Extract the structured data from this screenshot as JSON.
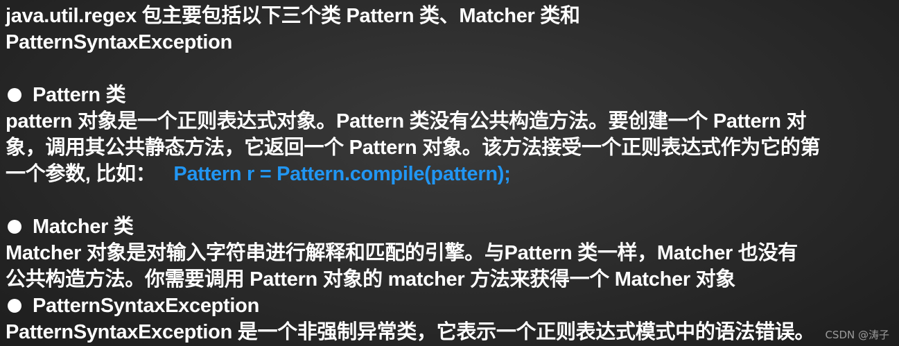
{
  "intro": {
    "line1": "java.util.regex 包主要包括以下三个类 Pattern 类、Matcher 类和",
    "line2": "PatternSyntaxException"
  },
  "pattern_section": {
    "title": "Pattern 类",
    "line1": "pattern 对象是一个正则表达式对象。Pattern 类没有公共构造方法。要创建一个 Pattern 对",
    "line2": "象，调用其公共静态方法，它返回一个 Pattern 对象。该方法接受一个正则表达式作为它的第",
    "line3": "一个参数, 比如：",
    "code": "Pattern r = Pattern.compile(pattern);"
  },
  "matcher_section": {
    "title": "Matcher 类",
    "line1": "Matcher 对象是对输入字符串进行解释和匹配的引擎。与Pattern 类一样，Matcher 也没有",
    "line2": "公共构造方法。你需要调用 Pattern 对象的 matcher 方法来获得一个 Matcher 对象"
  },
  "exception_section": {
    "title": "PatternSyntaxException",
    "line1": "PatternSyntaxException 是一个非强制异常类，它表示一个正则表达式模式中的语法错误。"
  },
  "watermark": "CSDN @涛子",
  "colors": {
    "background": "#2b2b2b",
    "text": "#ffffff",
    "code": "#2196f3"
  }
}
